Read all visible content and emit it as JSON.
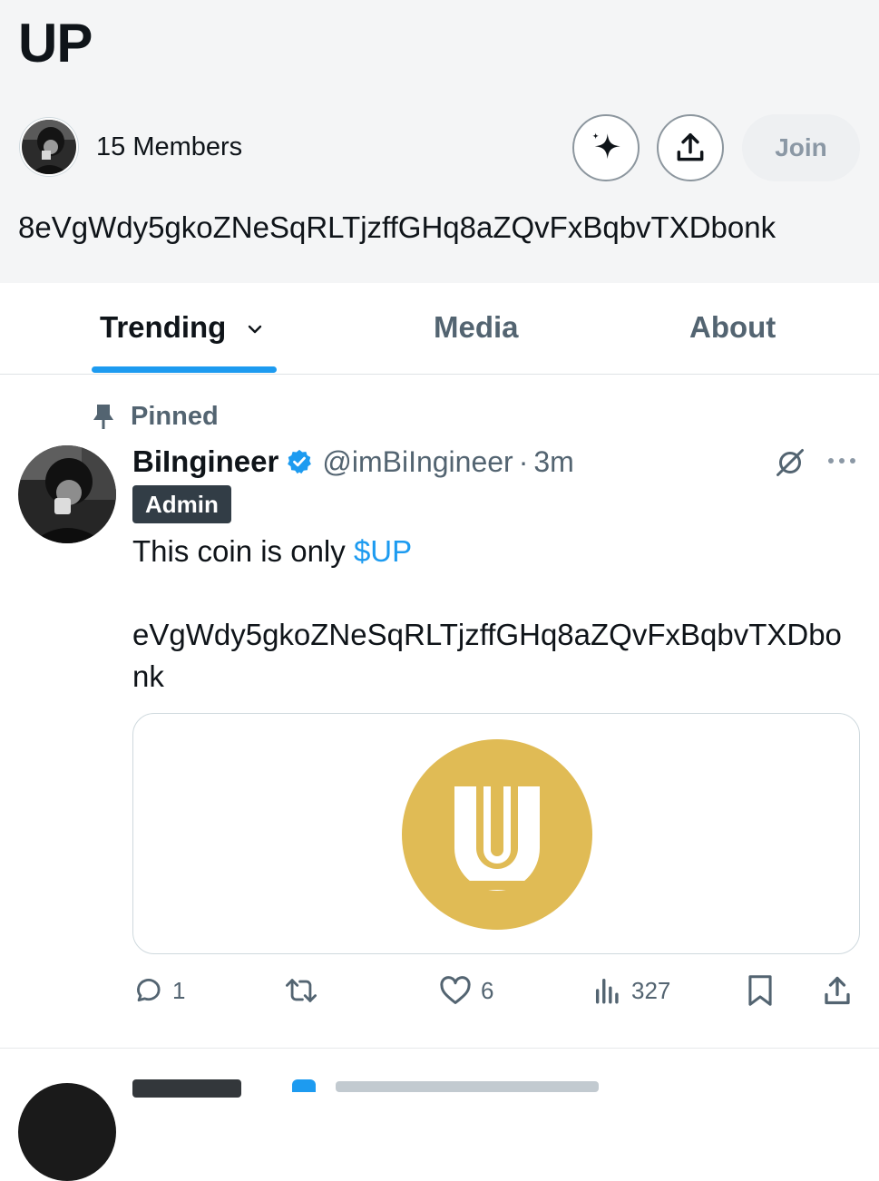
{
  "community": {
    "title": "UP",
    "members_label": "15 Members",
    "join_label": "Join",
    "description": "8eVgWdy5gkoZNeSqRLTjzffGHq8aZQvFxBqbvTXDbonk"
  },
  "tabs": [
    {
      "label": "Trending",
      "active": true
    },
    {
      "label": "Media",
      "active": false
    },
    {
      "label": "About",
      "active": false
    }
  ],
  "tweet": {
    "pinned_label": "Pinned",
    "display_name": "BiIngineer",
    "handle": "@imBiIngineer",
    "separator": "·",
    "time": "3m",
    "badge": "Admin",
    "text_prefix": "This coin is only ",
    "cashtag": "$UP",
    "contract": "eVgWdy5gkoZNeSqRLTjzffGHq8aZQvFxBqbvTXDbonk",
    "stats": {
      "replies": "1",
      "likes": "6",
      "views": "327"
    }
  },
  "colors": {
    "accent": "#1d9bf0",
    "coin_gold": "#e0bb55",
    "header_bg": "#f4f5f6",
    "admin_badge_bg": "#323d46"
  },
  "icons": {
    "header": [
      "sparkle-icon",
      "share-icon"
    ],
    "tweet": [
      "pin-icon",
      "verified-badge-icon",
      "grok-icon",
      "more-icon"
    ],
    "actions": [
      "reply-icon",
      "retweet-icon",
      "like-icon",
      "views-icon",
      "bookmark-icon",
      "share-icon"
    ]
  }
}
